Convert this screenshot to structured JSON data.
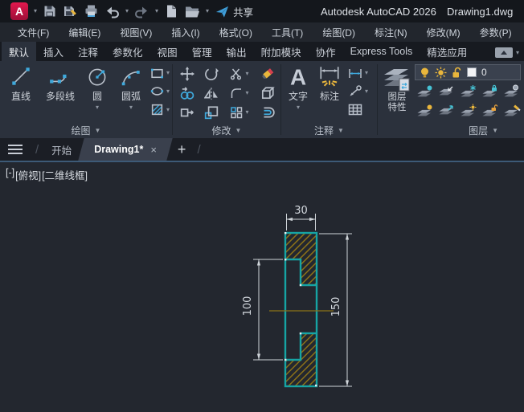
{
  "icons": {
    "logo_letter": "A",
    "text_tool_letter": "A",
    "caret_down": "▾",
    "panel_caret": "▼",
    "close": "×",
    "plus": "+",
    "slash": "/"
  },
  "title_bar": {
    "app_title": "Autodesk AutoCAD 2026",
    "doc_title": "Drawing1.dwg",
    "share_label": "共享"
  },
  "menu_bar": {
    "items": [
      "文件(F)",
      "编辑(E)",
      "视图(V)",
      "插入(I)",
      "格式(O)",
      "工具(T)",
      "绘图(D)",
      "标注(N)",
      "修改(M)",
      "参数(P)"
    ]
  },
  "ribbon": {
    "active_tab": "默认",
    "tabs": [
      "默认",
      "插入",
      "注释",
      "参数化",
      "视图",
      "管理",
      "输出",
      "附加模块",
      "协作",
      "Express Tools",
      "精选应用"
    ],
    "draw_panel": {
      "label": "绘图",
      "line_label": "直线",
      "polyline_label": "多段线",
      "circle_label": "圆",
      "arc_label": "圆弧"
    },
    "modify_panel": {
      "label": "修改"
    },
    "annotate_panel": {
      "label": "注释",
      "text_label": "文字",
      "dim_label": "标注"
    },
    "layer_panel": {
      "label": "图层",
      "props_line1": "图层",
      "props_line2": "特性",
      "current_layer": "0"
    }
  },
  "file_tabs": {
    "start_label": "开始",
    "active_label": "Drawing1*"
  },
  "viewport": {
    "minus": "[-]",
    "view": "[俯视]",
    "visual_style": "[二维线框]"
  },
  "drawing": {
    "dim_top": "30",
    "dim_right": "150",
    "dim_left": "100",
    "colors": {
      "outline": "#16a4a4",
      "hatch": "#8c7218",
      "centerline": "#8c7218",
      "dimension": "#d3d7dc",
      "background": "#23272f"
    }
  }
}
